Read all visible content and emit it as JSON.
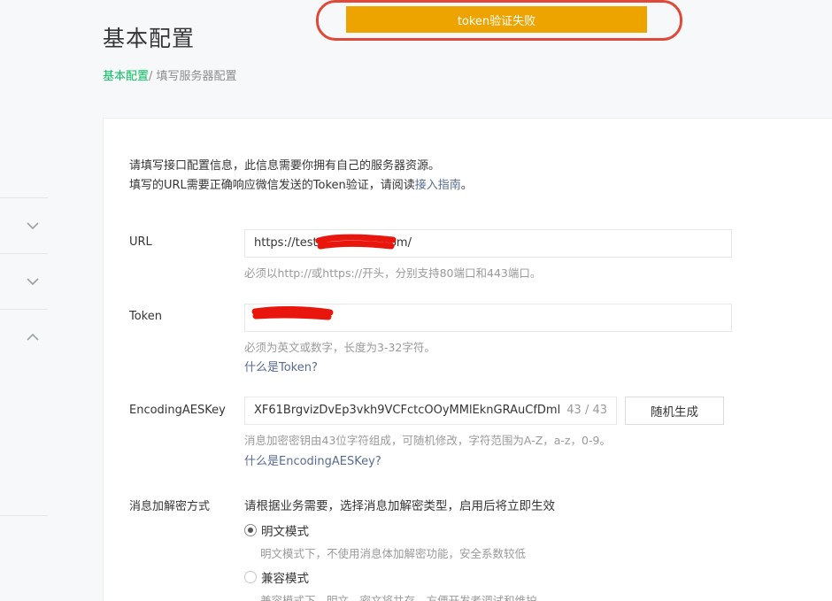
{
  "header": {
    "title": "基本配置",
    "breadcrumb_active": "基本配置",
    "breadcrumb_rest": "/ 填写服务器配置"
  },
  "toast": {
    "message": "token验证失败"
  },
  "intro": {
    "line1": "请填写接口配置信息，此信息需要你拥有自己的服务器资源。",
    "line2_prefix": "填写的URL需要正确响应微信发送的Token验证，请阅读",
    "line2_link": "接入指南",
    "line2_suffix": "。"
  },
  "form": {
    "url": {
      "label": "URL",
      "value": "https://test.",
      "value_suffix": ".com/",
      "hint": "必须以http://或https://开头，分别支持80端口和443端口。"
    },
    "token": {
      "label": "Token",
      "value": "",
      "hint": "必须为英文或数字，长度为3-32字符。",
      "help_link": "什么是Token?"
    },
    "aes_key": {
      "label": "EncodingAESKey",
      "value": "XF61BrgvizDvEp3vkh9VCFctcOOyMMlEknGRAuCfDml",
      "count": "43 / 43",
      "generate_button": "随机生成",
      "hint": "消息加密密钥由43位字符组成，可随机修改，字符范围为A-Z，a-z，0-9。",
      "help_link": "什么是EncodingAESKey?"
    },
    "encryption": {
      "label": "消息加解密方式",
      "description": "请根据业务需要，选择消息加解密类型，启用后将立即生效",
      "options": [
        {
          "label": "明文模式",
          "hint": "明文模式下，不使用消息体加解密功能，安全系数较低",
          "selected": true
        },
        {
          "label": "兼容模式",
          "hint": "兼容模式下，明文、密文将共存，方便开发者调试和维护",
          "selected": false
        }
      ]
    }
  },
  "colors": {
    "accent_green": "#07c160",
    "link_blue": "#576b95",
    "toast_bg": "#eda300",
    "annotation_red": "#e0493a"
  }
}
